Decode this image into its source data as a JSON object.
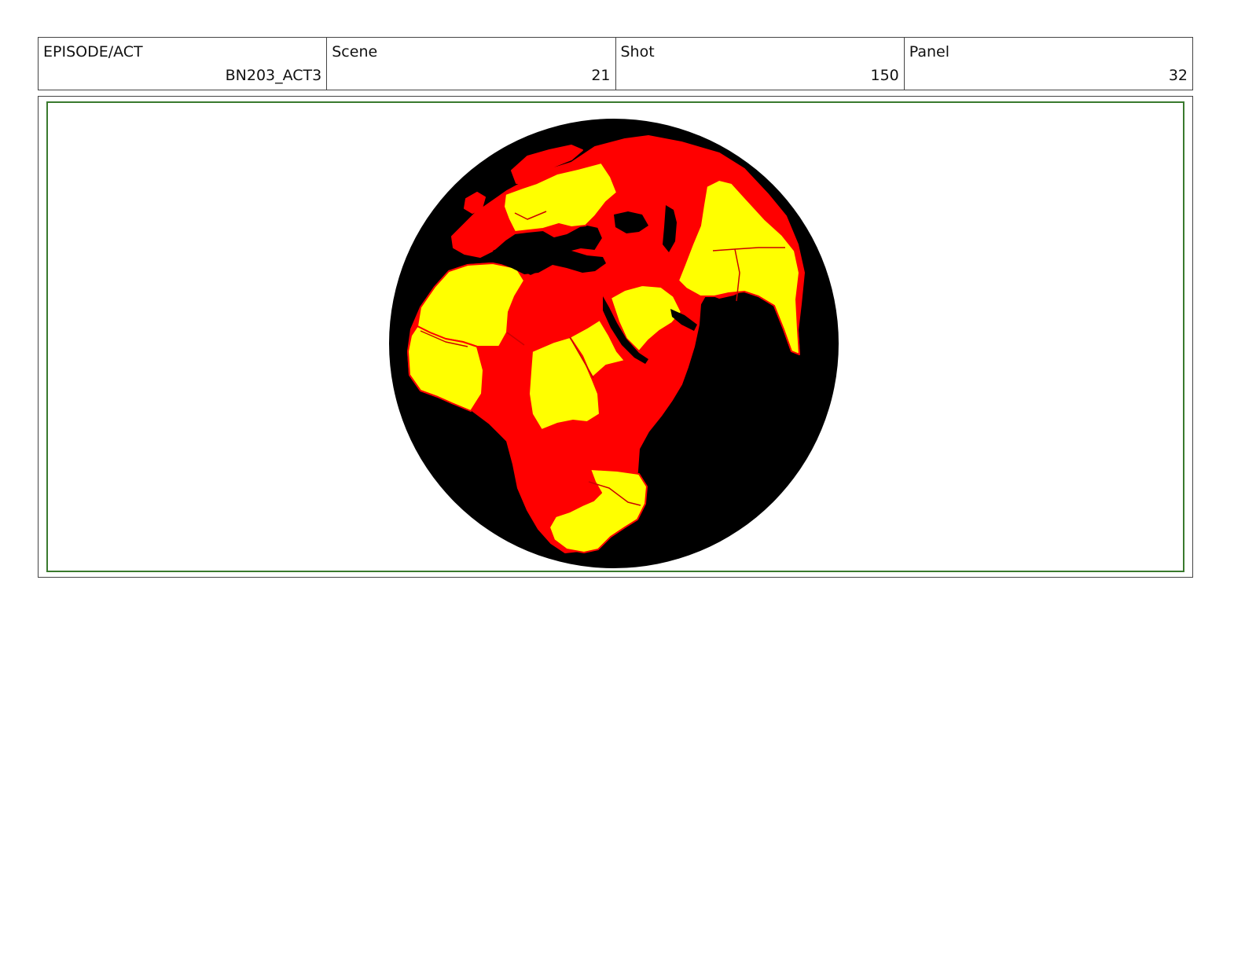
{
  "header": {
    "episode_label": "EPISODE/ACT",
    "episode_value": "BN203_ACT3",
    "scene_label": "Scene",
    "scene_value": "21",
    "shot_label": "Shot",
    "shot_value": "150",
    "panel_label": "Panel",
    "panel_value": "32"
  },
  "colors": {
    "frame_border": "#3a7a2e",
    "ocean": "#000000",
    "land_primary": "#ff0000",
    "land_secondary": "#ffff00"
  },
  "drawing": {
    "icon": "globe-africa-europe-icon"
  }
}
